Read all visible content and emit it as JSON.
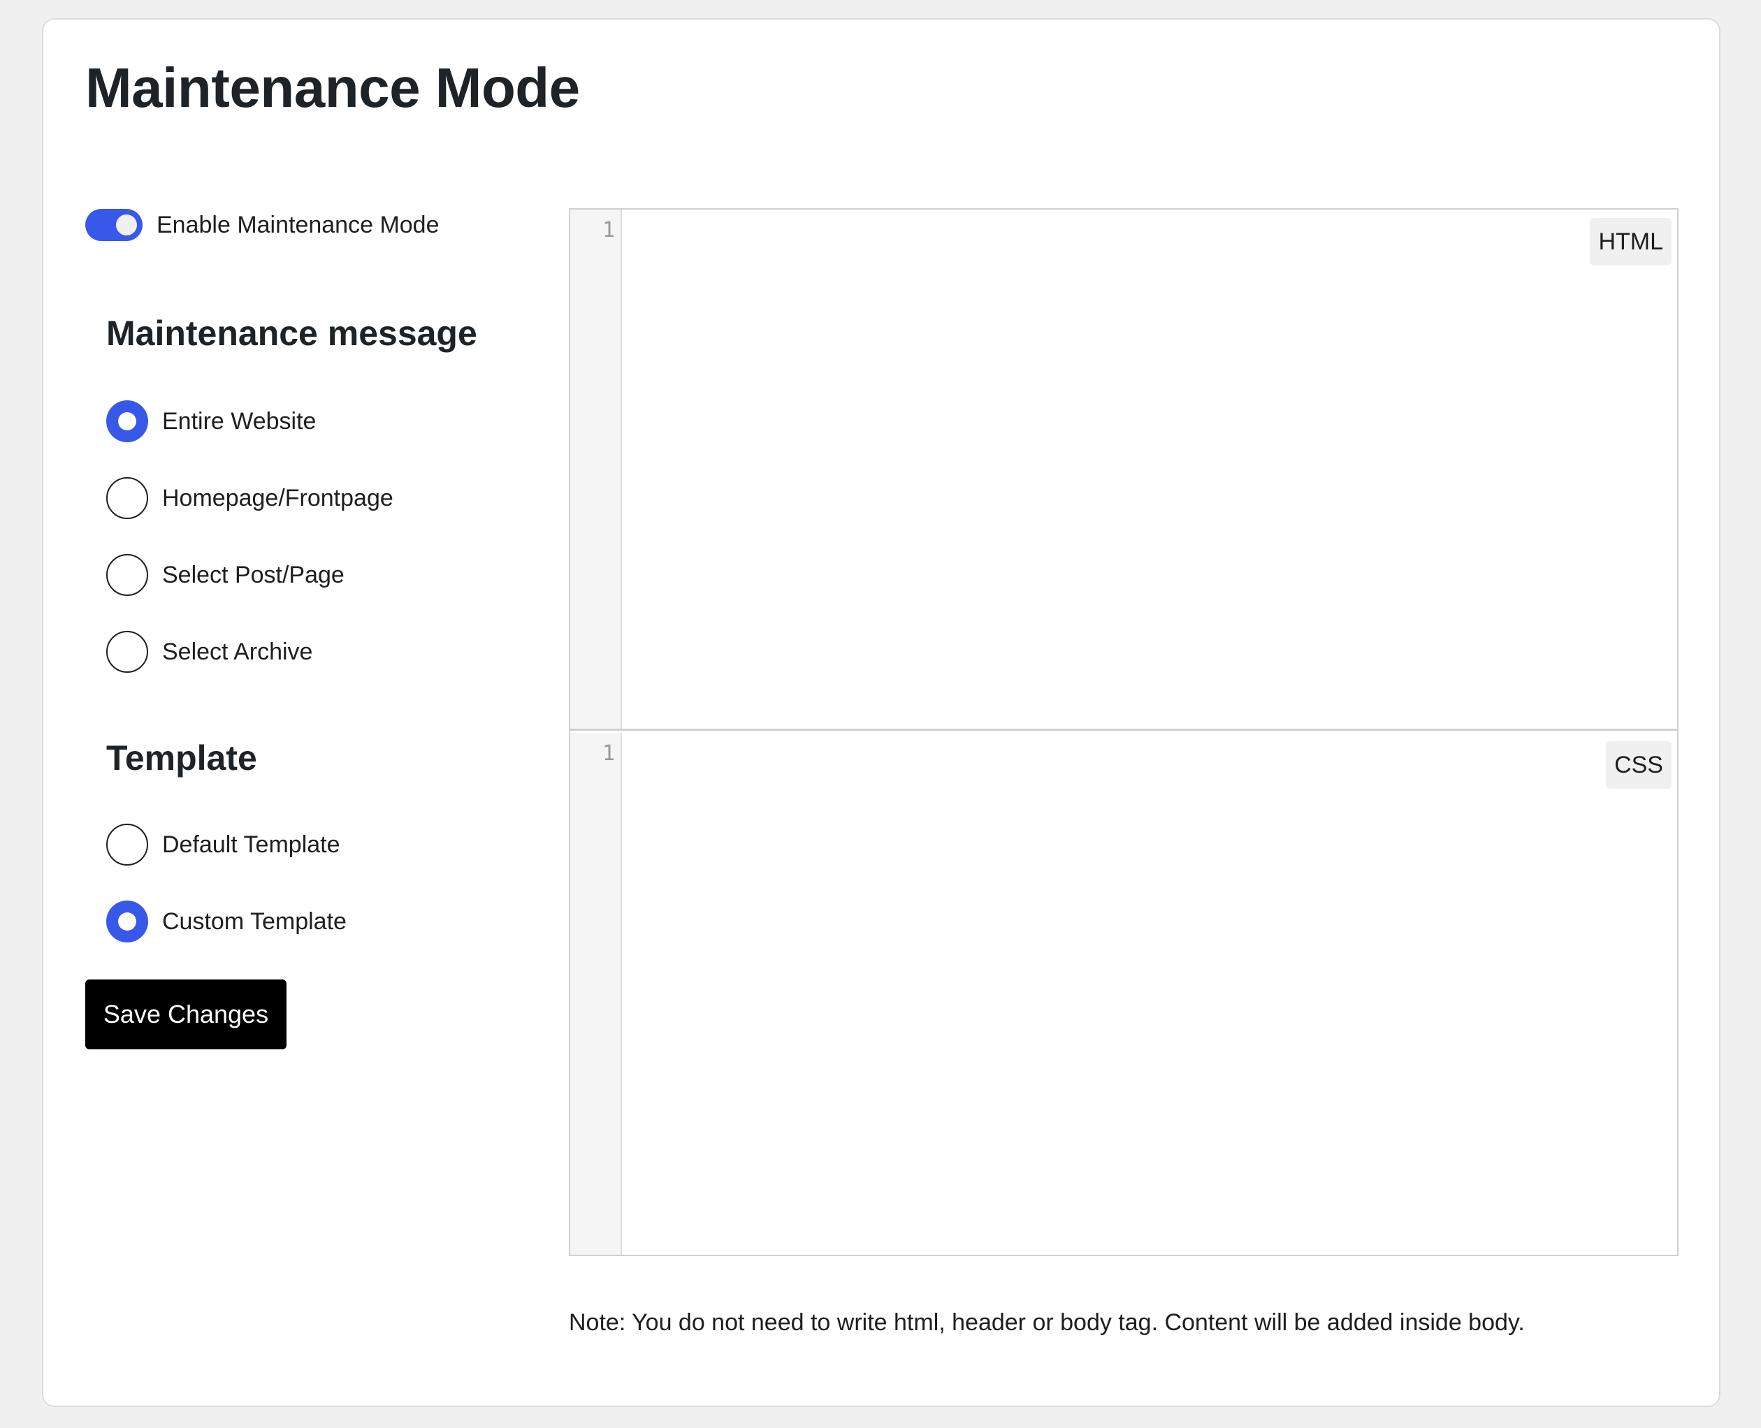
{
  "page": {
    "title": "Maintenance Mode"
  },
  "toggle": {
    "label": "Enable Maintenance Mode",
    "enabled": true
  },
  "maintenance_message": {
    "heading": "Maintenance message",
    "options": [
      {
        "label": "Entire Website",
        "checked": true
      },
      {
        "label": "Homepage/Frontpage",
        "checked": false
      },
      {
        "label": "Select Post/Page",
        "checked": false
      },
      {
        "label": "Select Archive",
        "checked": false
      }
    ]
  },
  "template": {
    "heading": "Template",
    "options": [
      {
        "label": "Default Template",
        "checked": false
      },
      {
        "label": "Custom Template",
        "checked": true
      }
    ]
  },
  "actions": {
    "save_label": "Save Changes"
  },
  "editors": {
    "html": {
      "badge": "HTML",
      "line_number": "1"
    },
    "css": {
      "badge": "CSS",
      "line_number": "1"
    }
  },
  "note": "Note: You do not need to write html, header or body tag. Content will be added inside body.",
  "colors": {
    "accent": "#3858e9",
    "button_bg": "#000000",
    "background": "#f0f0f0"
  }
}
